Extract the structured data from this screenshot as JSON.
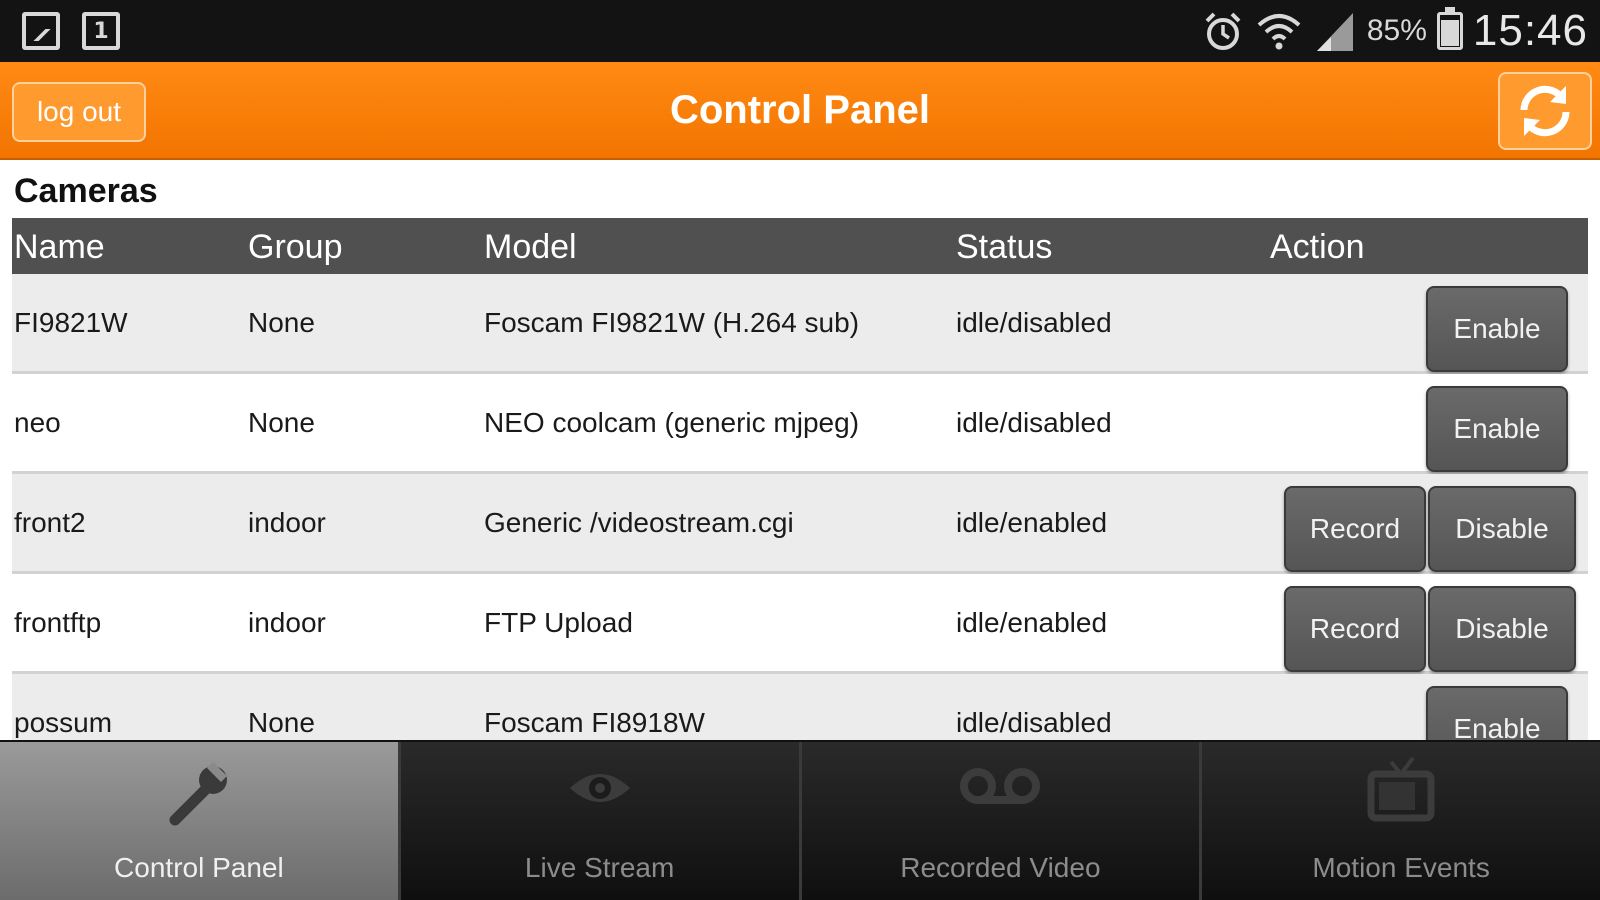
{
  "status_bar": {
    "battery_percent": "85%",
    "time": "15:46"
  },
  "action_bar": {
    "logout_label": "log out",
    "title": "Control Panel"
  },
  "section_title": "Cameras",
  "table": {
    "headers": {
      "name": "Name",
      "group": "Group",
      "model": "Model",
      "status": "Status",
      "action": "Action"
    },
    "rows": [
      {
        "name": "FI9821W",
        "group": "None",
        "model": "Foscam FI9821W (H.264 sub)",
        "status": "idle/disabled",
        "actions": [
          "Enable"
        ]
      },
      {
        "name": "neo",
        "group": "None",
        "model": "NEO coolcam (generic mjpeg)",
        "status": "idle/disabled",
        "actions": [
          "Enable"
        ]
      },
      {
        "name": "front2",
        "group": "indoor",
        "model": "Generic /videostream.cgi",
        "status": "idle/enabled",
        "actions": [
          "Record",
          "Disable"
        ]
      },
      {
        "name": "frontftp",
        "group": "indoor",
        "model": "FTP Upload",
        "status": "idle/enabled",
        "actions": [
          "Record",
          "Disable"
        ]
      },
      {
        "name": "possum",
        "group": "None",
        "model": "Foscam FI8918W",
        "status": "idle/disabled",
        "actions": [
          "Enable"
        ]
      }
    ]
  },
  "tabs": [
    {
      "label": "Control Panel",
      "icon": "wrench-icon",
      "active": true
    },
    {
      "label": "Live Stream",
      "icon": "eye-icon",
      "active": false
    },
    {
      "label": "Recorded Video",
      "icon": "voicemail-tape-icon",
      "active": false
    },
    {
      "label": "Motion Events",
      "icon": "tv-icon",
      "active": false
    }
  ],
  "colors": {
    "accent": "#f27500",
    "header_bg": "#505050",
    "button_bg": "#5f5f5f"
  }
}
